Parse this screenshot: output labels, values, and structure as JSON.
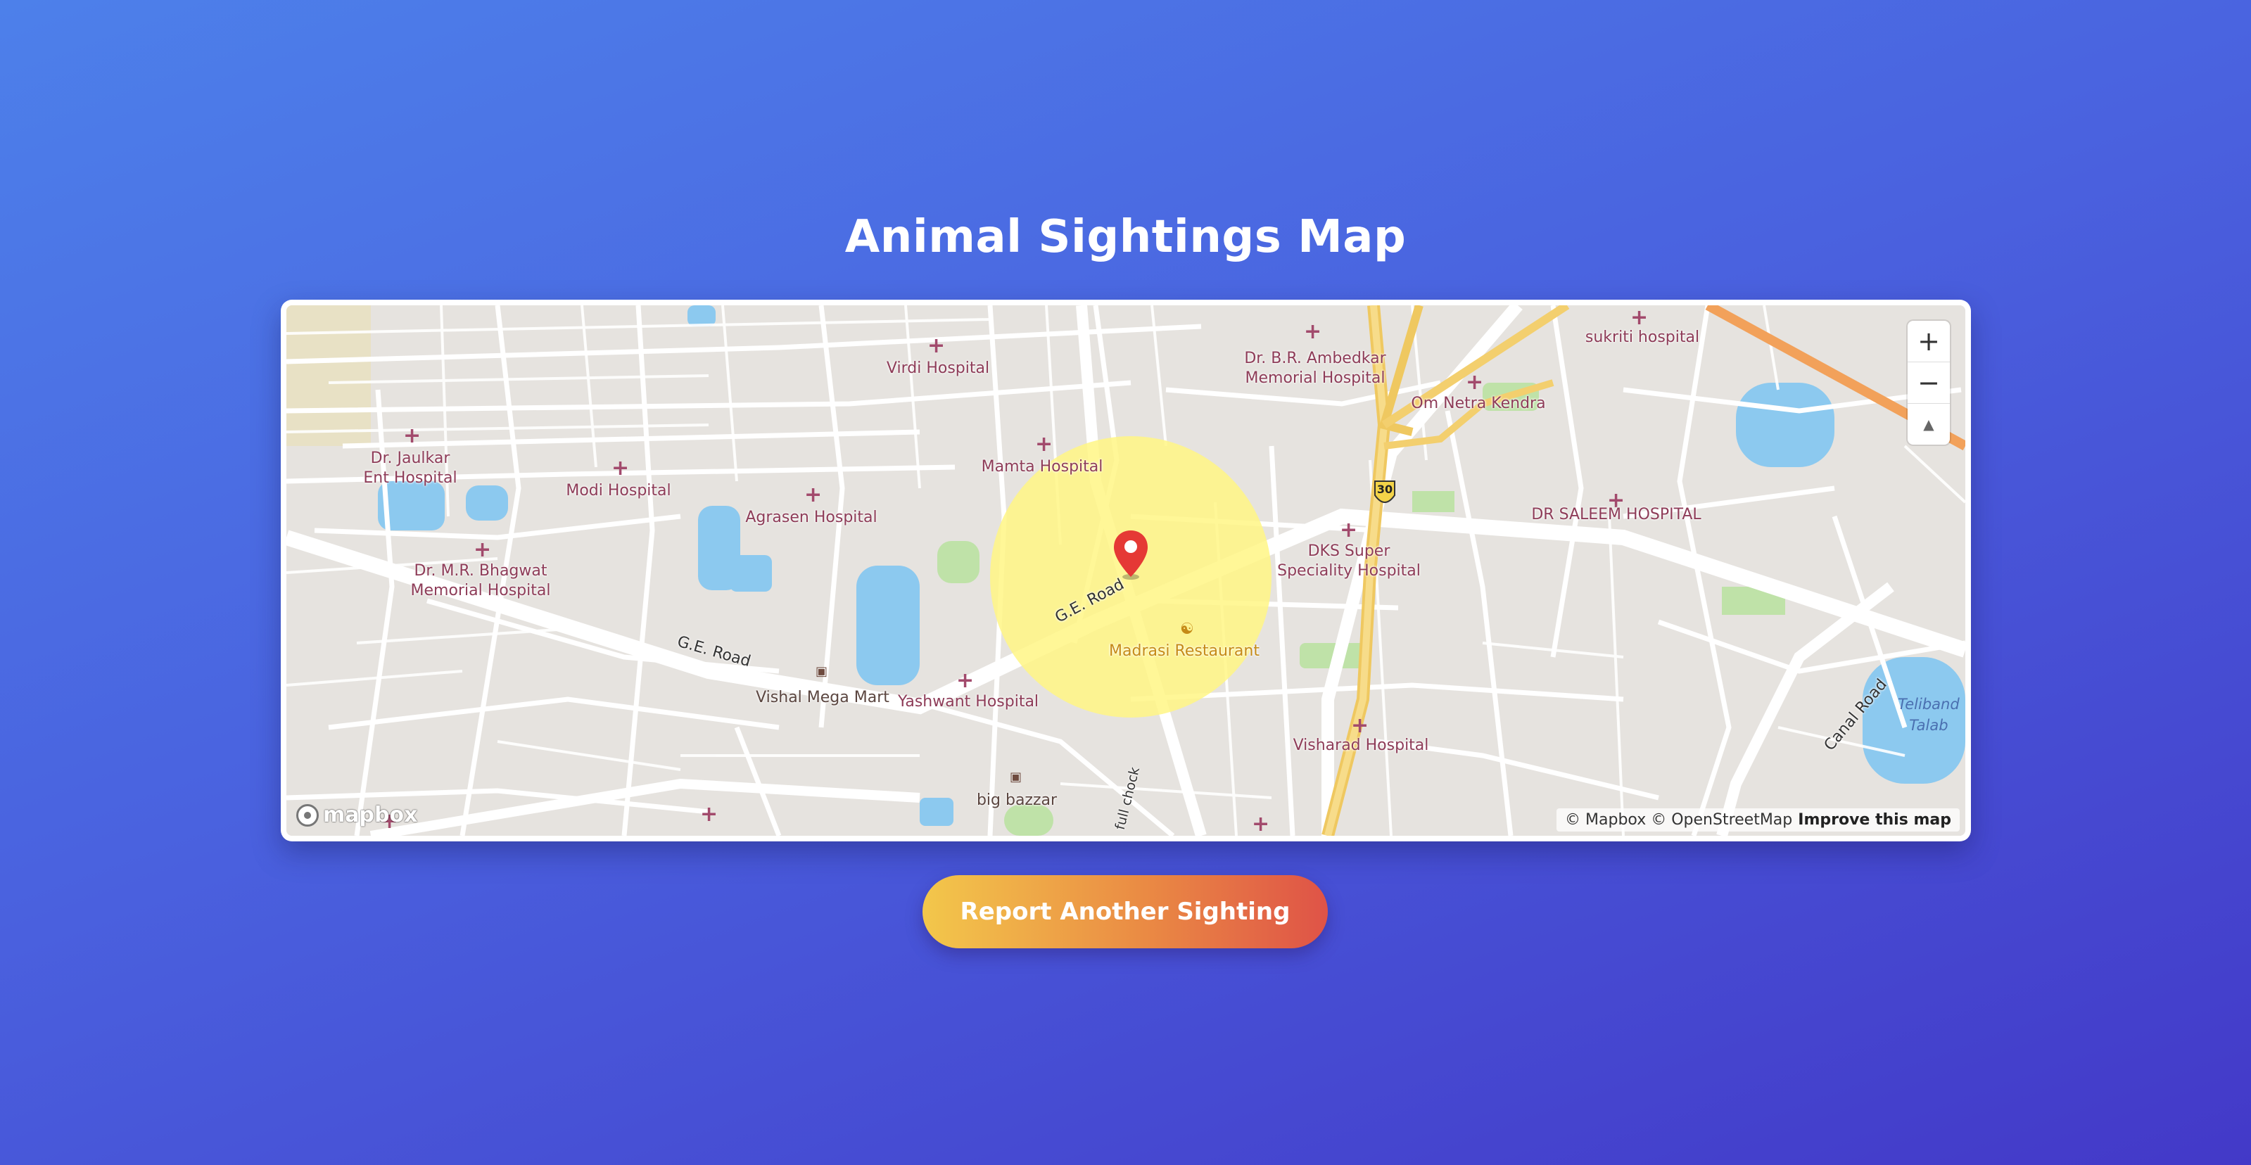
{
  "header": {
    "title": "Animal Sightings Map"
  },
  "map": {
    "poi_hospitals": [
      "Virdi Hospital",
      "Dr. B.R. Ambedkar\nMemorial Hospital",
      "sukriti hospital",
      "Om Netra Kendra",
      "Dr. Jaulkar\nEnt Hospital",
      "Modi Hospital",
      "Mamta Hospital",
      "Agrasen Hospital",
      "DR SALEEM HOSPITAL",
      "Dr. M.R. Bhagwat\nMemorial Hospital",
      "DKS Super\nSpeciality Hospital",
      "Yashwant Hospital",
      "Visharad Hospital"
    ],
    "poi_shops": [
      "Vishal Mega Mart",
      "big bazzar"
    ],
    "poi_food": [
      "Madrasi Restaurant"
    ],
    "roads": [
      "G.E. Road",
      "G.E. Road",
      "Canal Road",
      "full chock"
    ],
    "highway_shield": "30",
    "water": "Teliband\nTalab",
    "marker": {
      "type": "map-pin",
      "color": "#e53935"
    },
    "highlight_circle": {
      "color": "#fff58a"
    },
    "controls": {
      "zoom_in": "+",
      "zoom_out": "−",
      "compass": "▲"
    },
    "logo_text": "mapbox",
    "attribution": "© Mapbox © OpenStreetMap",
    "improve_link": "Improve this map"
  },
  "cta": {
    "label": "Report Another Sighting"
  },
  "colors": {
    "accent_start": "#f3c74b",
    "accent_end": "#df5347",
    "background": "#4a62df"
  }
}
